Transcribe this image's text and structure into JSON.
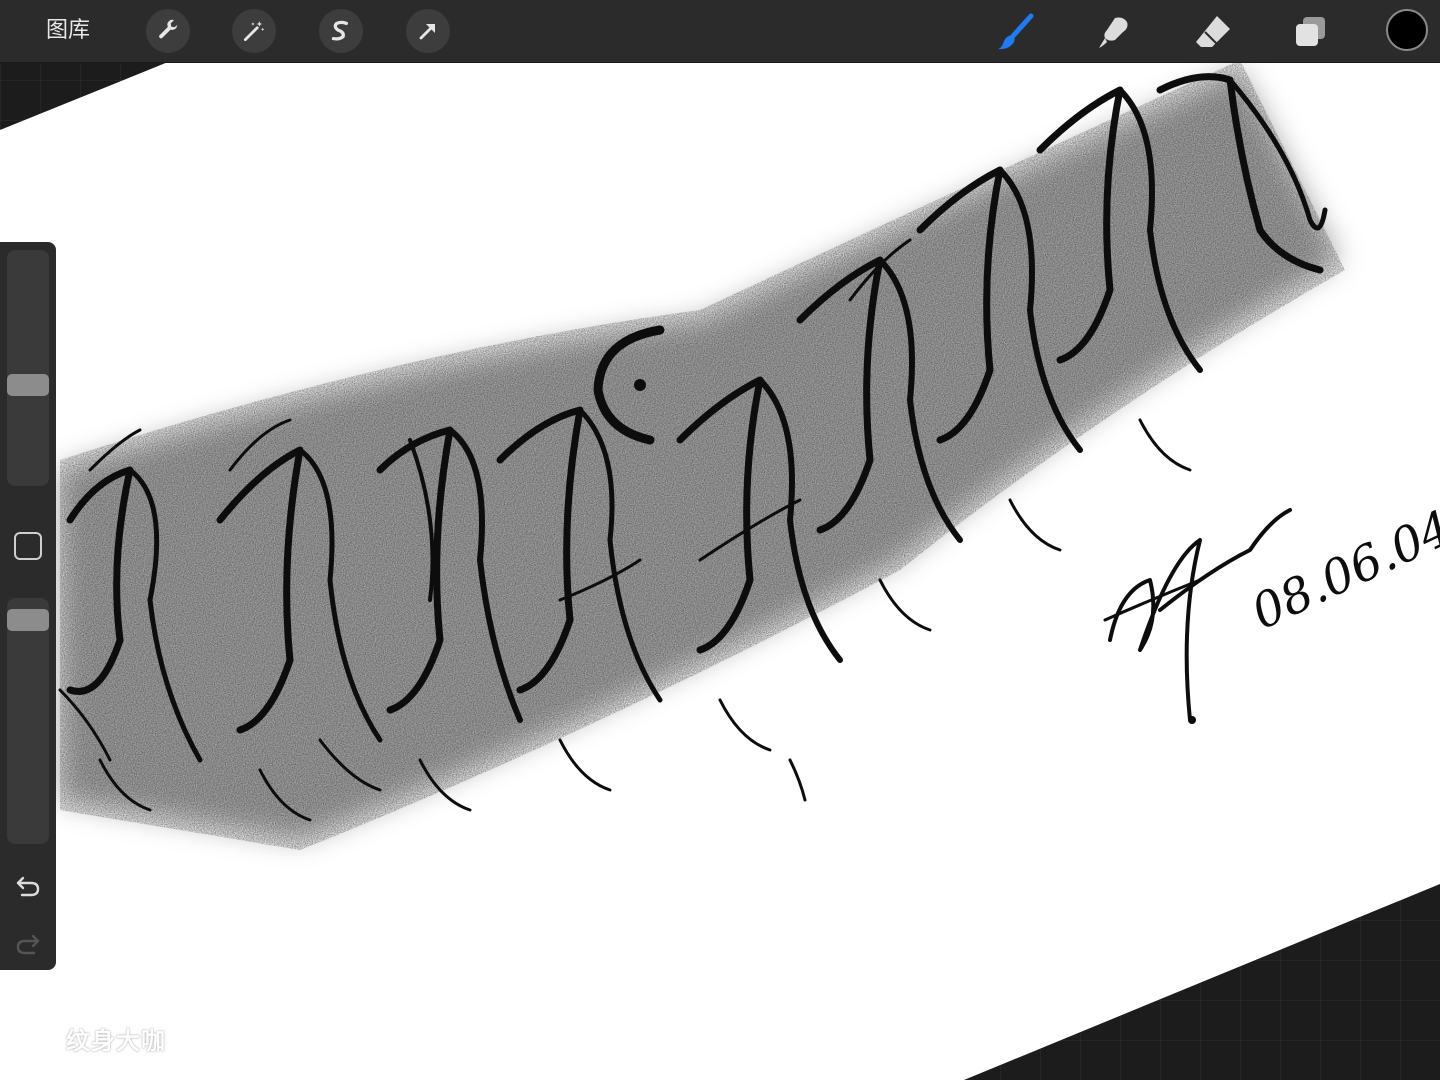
{
  "app": {
    "gallery_label": "图库"
  },
  "toolbar_left": [
    {
      "name": "actions",
      "icon": "wrench-icon"
    },
    {
      "name": "adjustments",
      "icon": "magic-wand-icon"
    },
    {
      "name": "selection",
      "icon": "selection-s-icon"
    },
    {
      "name": "transform",
      "icon": "arrow-cursor-icon"
    }
  ],
  "toolbar_right": [
    {
      "name": "brush",
      "icon": "brush-icon",
      "active": true
    },
    {
      "name": "smudge",
      "icon": "smudge-icon"
    },
    {
      "name": "eraser",
      "icon": "eraser-icon"
    },
    {
      "name": "layers",
      "icon": "layers-icon"
    }
  ],
  "color": {
    "current": "#000000",
    "accent": "#1e7bf2"
  },
  "sidebar": {
    "brush_size": 0.42,
    "brush_opacity": 0.95,
    "modify_icon": "square-icon",
    "undo_icon": "undo-icon",
    "redo_icon": "redo-icon"
  },
  "artwork": {
    "signature_date": "08.06.04"
  },
  "watermark": {
    "text": "纹身大咖",
    "icon": "owl-logo-icon"
  }
}
